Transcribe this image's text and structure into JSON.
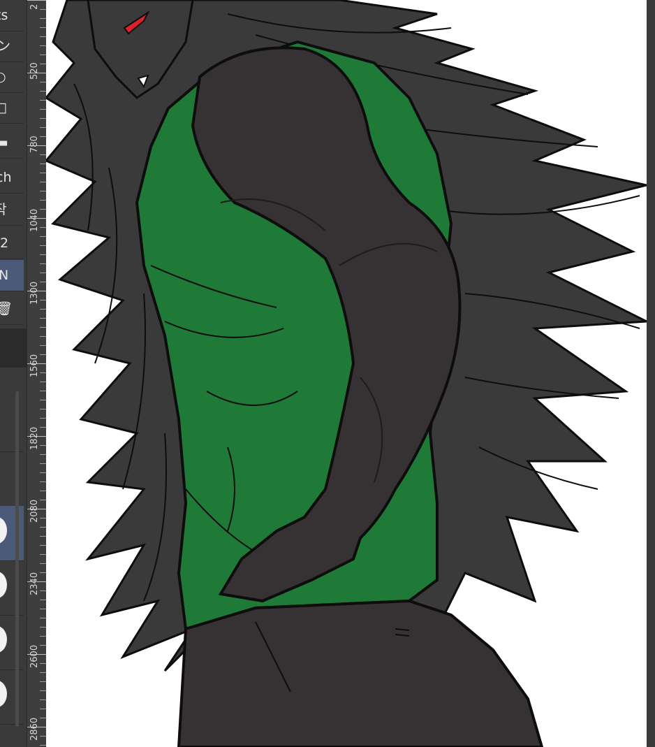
{
  "palette": {
    "items": [
      {
        "label": "ts",
        "icon": "text-icon"
      },
      {
        "label": "ン",
        "icon": "katakana-glyph-icon"
      },
      {
        "label": "○",
        "icon": "ellipse-icon"
      },
      {
        "label": "□",
        "icon": "rectangle-icon"
      },
      {
        "label": "▬",
        "icon": "bar-icon"
      },
      {
        "label": "ch",
        "icon": "text-icon"
      },
      {
        "label": "작",
        "icon": "hangul-glyph-icon"
      },
      {
        "label": "2",
        "icon": "number-icon"
      },
      {
        "label": "N",
        "icon": "letter-icon"
      },
      {
        "label": "🗑",
        "icon": "trash-icon"
      }
    ],
    "brushes": [
      "brush-preset",
      "brush-preset",
      "brush-preset",
      "brush-preset",
      "brush-preset"
    ]
  },
  "ruler": {
    "labels": [
      "2",
      "520",
      "780",
      "1040",
      "1300",
      "1560",
      "1820",
      "2080",
      "2340",
      "2600",
      "2860"
    ]
  },
  "canvas": {
    "colors": {
      "hair": "#3b3a3b",
      "skin": "#363233",
      "tank_top": "#1f7a37",
      "eye": "#e0202a",
      "line": "#0d0d0d"
    }
  }
}
